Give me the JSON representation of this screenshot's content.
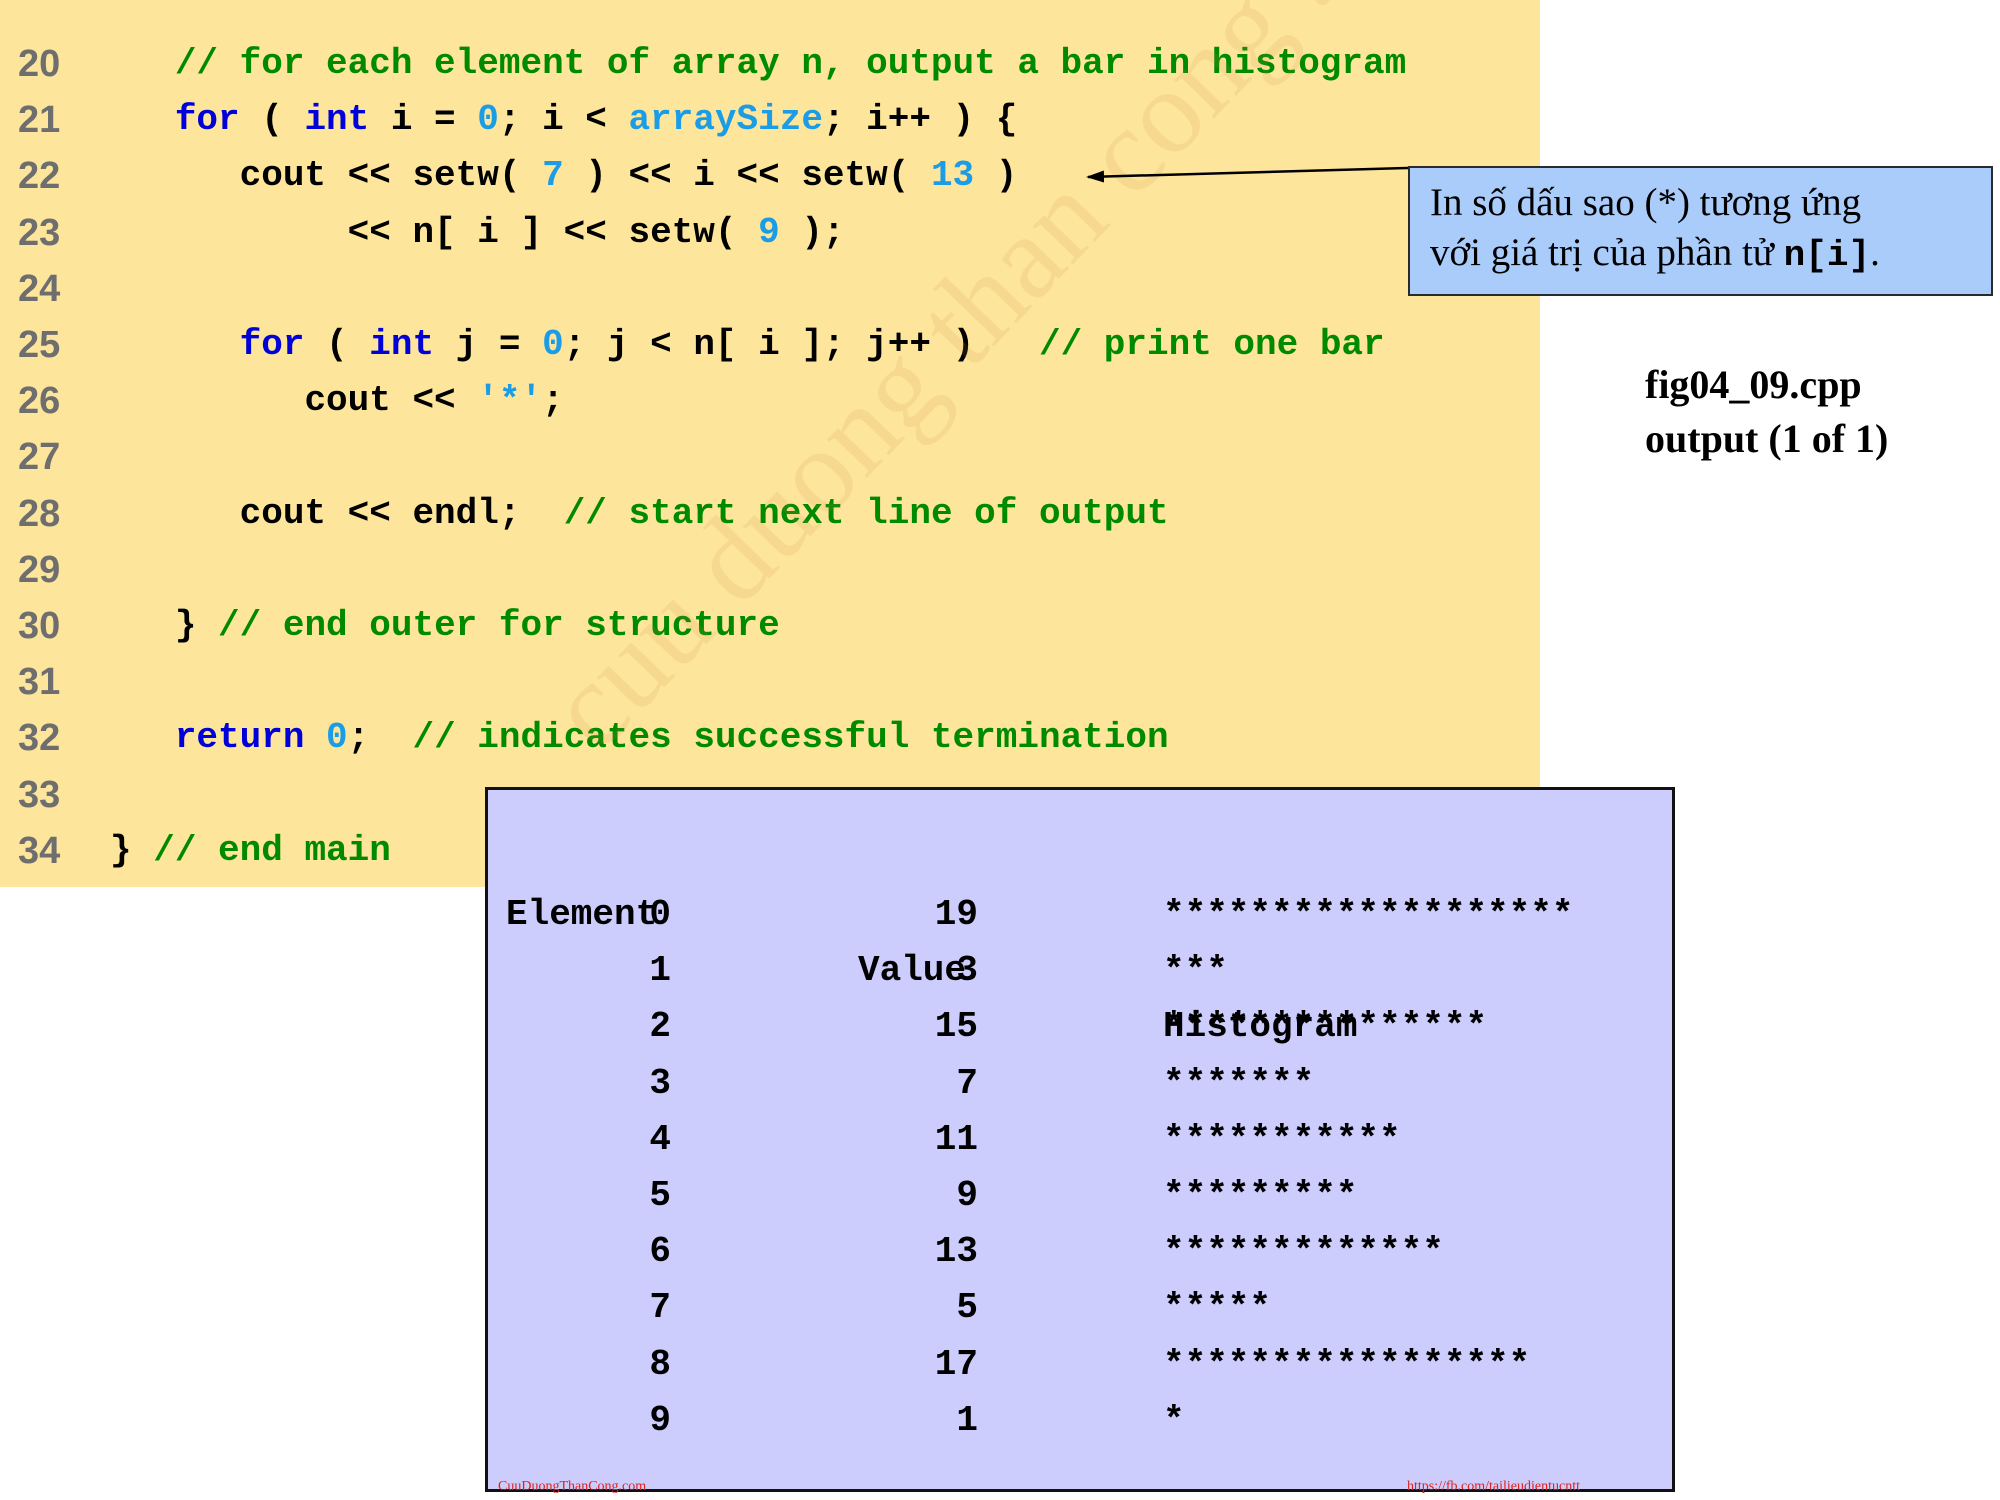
{
  "code": {
    "lines": [
      {
        "num": "20",
        "indent": "   ",
        "tokens": [
          {
            "t": "// for each element of array n, output a bar in histogram",
            "c": "cm"
          }
        ]
      },
      {
        "num": "21",
        "indent": "   ",
        "tokens": [
          {
            "t": "for",
            "c": "kw"
          },
          {
            "t": " ( ",
            "c": "pl"
          },
          {
            "t": "int",
            "c": "kw"
          },
          {
            "t": " i = ",
            "c": "pl"
          },
          {
            "t": "0",
            "c": "num"
          },
          {
            "t": "; i < ",
            "c": "pl"
          },
          {
            "t": "arraySize",
            "c": "num"
          },
          {
            "t": "; i++ ) {",
            "c": "pl"
          }
        ]
      },
      {
        "num": "22",
        "indent": "      ",
        "tokens": [
          {
            "t": "cout << setw( ",
            "c": "pl"
          },
          {
            "t": "7",
            "c": "num"
          },
          {
            "t": " ) << i << setw( ",
            "c": "pl"
          },
          {
            "t": "13",
            "c": "num"
          },
          {
            "t": " )",
            "c": "pl"
          }
        ]
      },
      {
        "num": "23",
        "indent": "           ",
        "tokens": [
          {
            "t": "<< n[ i ] << setw( ",
            "c": "pl"
          },
          {
            "t": "9",
            "c": "num"
          },
          {
            "t": " );",
            "c": "pl"
          }
        ]
      },
      {
        "num": "24",
        "indent": "",
        "tokens": []
      },
      {
        "num": "25",
        "indent": "      ",
        "tokens": [
          {
            "t": "for",
            "c": "kw"
          },
          {
            "t": " ( ",
            "c": "pl"
          },
          {
            "t": "int",
            "c": "kw"
          },
          {
            "t": " j = ",
            "c": "pl"
          },
          {
            "t": "0",
            "c": "num"
          },
          {
            "t": "; j < n[ i ]; j++ )   ",
            "c": "pl"
          },
          {
            "t": "// print one bar",
            "c": "cm"
          }
        ]
      },
      {
        "num": "26",
        "indent": "         ",
        "tokens": [
          {
            "t": "cout << ",
            "c": "pl"
          },
          {
            "t": "'*'",
            "c": "num"
          },
          {
            "t": ";",
            "c": "pl"
          }
        ]
      },
      {
        "num": "27",
        "indent": "",
        "tokens": []
      },
      {
        "num": "28",
        "indent": "      ",
        "tokens": [
          {
            "t": "cout << endl;  ",
            "c": "pl"
          },
          {
            "t": "// start next line of output",
            "c": "cm"
          }
        ]
      },
      {
        "num": "29",
        "indent": "",
        "tokens": []
      },
      {
        "num": "30",
        "indent": "   ",
        "tokens": [
          {
            "t": "} ",
            "c": "pl"
          },
          {
            "t": "// end outer for structure",
            "c": "cm"
          }
        ]
      },
      {
        "num": "31",
        "indent": "",
        "tokens": []
      },
      {
        "num": "32",
        "indent": "   ",
        "tokens": [
          {
            "t": "return",
            "c": "kw"
          },
          {
            "t": " ",
            "c": "pl"
          },
          {
            "t": "0",
            "c": "num"
          },
          {
            "t": ";  ",
            "c": "pl"
          },
          {
            "t": "// indicates successful termination",
            "c": "cm"
          }
        ]
      },
      {
        "num": "33",
        "indent": "",
        "tokens": []
      },
      {
        "num": "34",
        "indent": "",
        "tokens": [
          {
            "t": "} ",
            "c": "pl"
          },
          {
            "t": "// end main",
            "c": "cm"
          }
        ]
      }
    ]
  },
  "callout": {
    "line1": "In số dấu sao (*) tương ứng",
    "line2_prefix": "với giá trị của phần tử ",
    "line2_code": "n[i]",
    "line2_suffix": "."
  },
  "caption": {
    "line1": "fig04_09.cpp",
    "line2": "output (1 of 1)"
  },
  "output": {
    "headers": {
      "element": "Element",
      "value": "Value",
      "histogram": "Histogram"
    },
    "rows": [
      {
        "element": "0",
        "value": "19",
        "bar": "*******************"
      },
      {
        "element": "1",
        "value": "3",
        "bar": "***"
      },
      {
        "element": "2",
        "value": "15",
        "bar": "***************"
      },
      {
        "element": "3",
        "value": "7",
        "bar": "*******"
      },
      {
        "element": "4",
        "value": "11",
        "bar": "***********"
      },
      {
        "element": "5",
        "value": "9",
        "bar": "*********"
      },
      {
        "element": "6",
        "value": "13",
        "bar": "*************"
      },
      {
        "element": "7",
        "value": "5",
        "bar": "*****"
      },
      {
        "element": "8",
        "value": "17",
        "bar": "*****************"
      },
      {
        "element": "9",
        "value": "1",
        "bar": "*"
      }
    ]
  },
  "footer": {
    "left": "CuuDuongThanCong.com",
    "right": "https://fb.com/tailieudientucntt"
  },
  "watermark": "cuu duong than cong . com",
  "colors": {
    "code_bg": "#fde59b",
    "keyword": "#0000d8",
    "number": "#1a9ce6",
    "comment": "#008a00",
    "callout_bg": "#a9ccfb",
    "output_bg": "#ccccfd"
  }
}
